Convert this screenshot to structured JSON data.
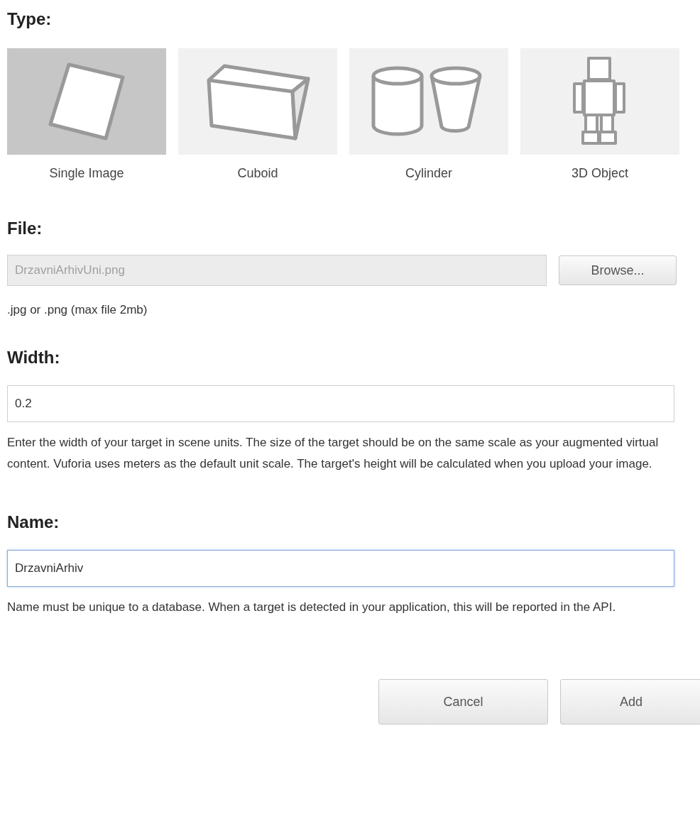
{
  "type_section": {
    "heading": "Type:",
    "options": [
      {
        "kind": "single_image",
        "label": "Single Image",
        "selected": true
      },
      {
        "kind": "cuboid",
        "label": "Cuboid",
        "selected": false
      },
      {
        "kind": "cylinder",
        "label": "Cylinder",
        "selected": false
      },
      {
        "kind": "object_3d",
        "label": "3D Object",
        "selected": false
      }
    ]
  },
  "file_section": {
    "heading": "File:",
    "value": "DrzavniArhivUni.png",
    "disabled": true,
    "browse_button": "Browse...",
    "hint": ".jpg or .png (max file 2mb)"
  },
  "width_section": {
    "heading": "Width:",
    "value": "0.2",
    "help": "Enter the width of your target in scene units. The size of the target should be on the same scale as your augmented virtual content. Vuforia uses meters as the default unit scale. The target's height will be calculated when you upload your image."
  },
  "name_section": {
    "heading": "Name:",
    "value": "DrzavniArhiv",
    "focused": true,
    "help": "Name must be unique to a database. When a target is detected in your application, this will be reported in the API."
  },
  "buttons": [
    "Cancel",
    "Add"
  ]
}
